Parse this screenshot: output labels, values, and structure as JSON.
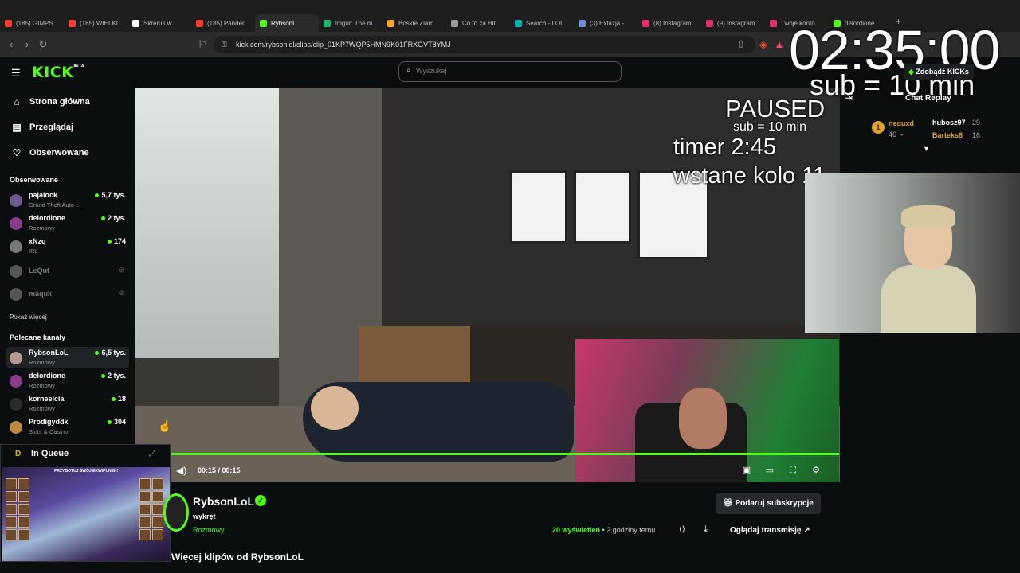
{
  "browser": {
    "tabs": [
      {
        "label": "(185) GIMPS",
        "color": "#ff3b30"
      },
      {
        "label": "(185) WIELKI",
        "color": "#ff3b30"
      },
      {
        "label": "Skrerus w",
        "color": "#ffffff"
      },
      {
        "label": "(185) Pander",
        "color": "#ff3b30"
      },
      {
        "label": "RybsonL",
        "color": "#53fc18",
        "active": true
      },
      {
        "label": "Imgur: The m",
        "color": "#1bb76e"
      },
      {
        "label": "Boskie Ziarn",
        "color": "#f5a623"
      },
      {
        "label": "Co to za Hit",
        "color": "#999999"
      },
      {
        "label": "Search - LOL",
        "color": "#00b3b3"
      },
      {
        "label": "(3) Extazja -",
        "color": "#7289da"
      },
      {
        "label": "(8) Instagram",
        "color": "#e1306c"
      },
      {
        "label": "(9) Instagram",
        "color": "#e1306c"
      },
      {
        "label": "Twoje konto",
        "color": "#e1306c"
      },
      {
        "label": "delordione",
        "color": "#53fc18"
      }
    ],
    "url": "kick.com/rybsonlol/clips/clip_01KP7WQP5HMN9K01FRXGVT8YMJ"
  },
  "header": {
    "logo": "KICK",
    "logo_badge": "BETA",
    "search_placeholder": "Wyszukaj",
    "kicks_button": "Zdobądź KICKs"
  },
  "sidebar": {
    "nav": [
      {
        "label": "Strona główna",
        "icon": "home-icon"
      },
      {
        "label": "Przeglądaj",
        "icon": "browse-icon"
      },
      {
        "label": "Obserwowane",
        "icon": "heart-icon"
      }
    ],
    "following_title": "Obserwowane",
    "following": [
      {
        "name": "pajalock",
        "category": "Grand Theft Auto ...",
        "viewers": "5,7 tys.",
        "avatar": "#6b5b8e"
      },
      {
        "name": "delordione",
        "category": "Rozmowy",
        "viewers": "2 tys.",
        "avatar": "#8a3c8c"
      },
      {
        "name": "xNzq",
        "category": "IRL",
        "viewers": "174",
        "avatar": "#777777"
      },
      {
        "name": "LeQut",
        "offline": true,
        "avatar": "#555555"
      },
      {
        "name": "maquk",
        "offline": true,
        "avatar": "#555555"
      }
    ],
    "show_more": "Pokaż więcej",
    "recommended_title": "Polecane kanały",
    "recommended": [
      {
        "name": "RybsonLoL",
        "category": "Rozmowy",
        "viewers": "6,5 tys.",
        "avatar": "#b59a8c",
        "active": true
      },
      {
        "name": "delordione",
        "category": "Rozmowy",
        "viewers": "2 tys.",
        "avatar": "#8a3c8c"
      },
      {
        "name": "korneelcia",
        "category": "Rozmowy",
        "viewers": "18",
        "avatar": "#2b2b2b"
      },
      {
        "name": "Prodigyddk",
        "category": "Slots & Casino",
        "viewers": "304",
        "avatar": "#c08a3e"
      }
    ]
  },
  "overlay": {
    "timer": "02:35:00",
    "sub_rule": "sub = 10 min",
    "paused": "PAUSED",
    "sub_rule_small": "sub = 10 min",
    "timer_small": "timer 2:45",
    "wake": "wstane kolo 11"
  },
  "player": {
    "time": "00:15 / 00:15",
    "progress": 1.0
  },
  "chat": {
    "title": "Chat Replay",
    "leaderboard": [
      {
        "rank": "1",
        "name": "nequxd",
        "value": "46",
        "color": "#e0a42c"
      },
      {
        "name": "hubosz97",
        "value": "29",
        "color": "#ffffff"
      },
      {
        "name": "Barteks8",
        "value": "16",
        "color": "#e0a42c"
      }
    ]
  },
  "miniplayer": {
    "logo": "D",
    "title": "In Queue",
    "banner": "PRZYGOTUJ SWÓJ EKWIPUNEK!"
  },
  "clip": {
    "channel": "RybsonLoL",
    "title": "wykręt",
    "category": "Rozmowy",
    "views_count": "20",
    "views_label": "wyświetleń",
    "time_ago": "• 2 godziny temu",
    "subscribe_gift": "Podaruj subskrypcje",
    "watch_stream": "Oglądaj transmisję",
    "more_clips": "Więcej klipów od RybsonLoL"
  }
}
